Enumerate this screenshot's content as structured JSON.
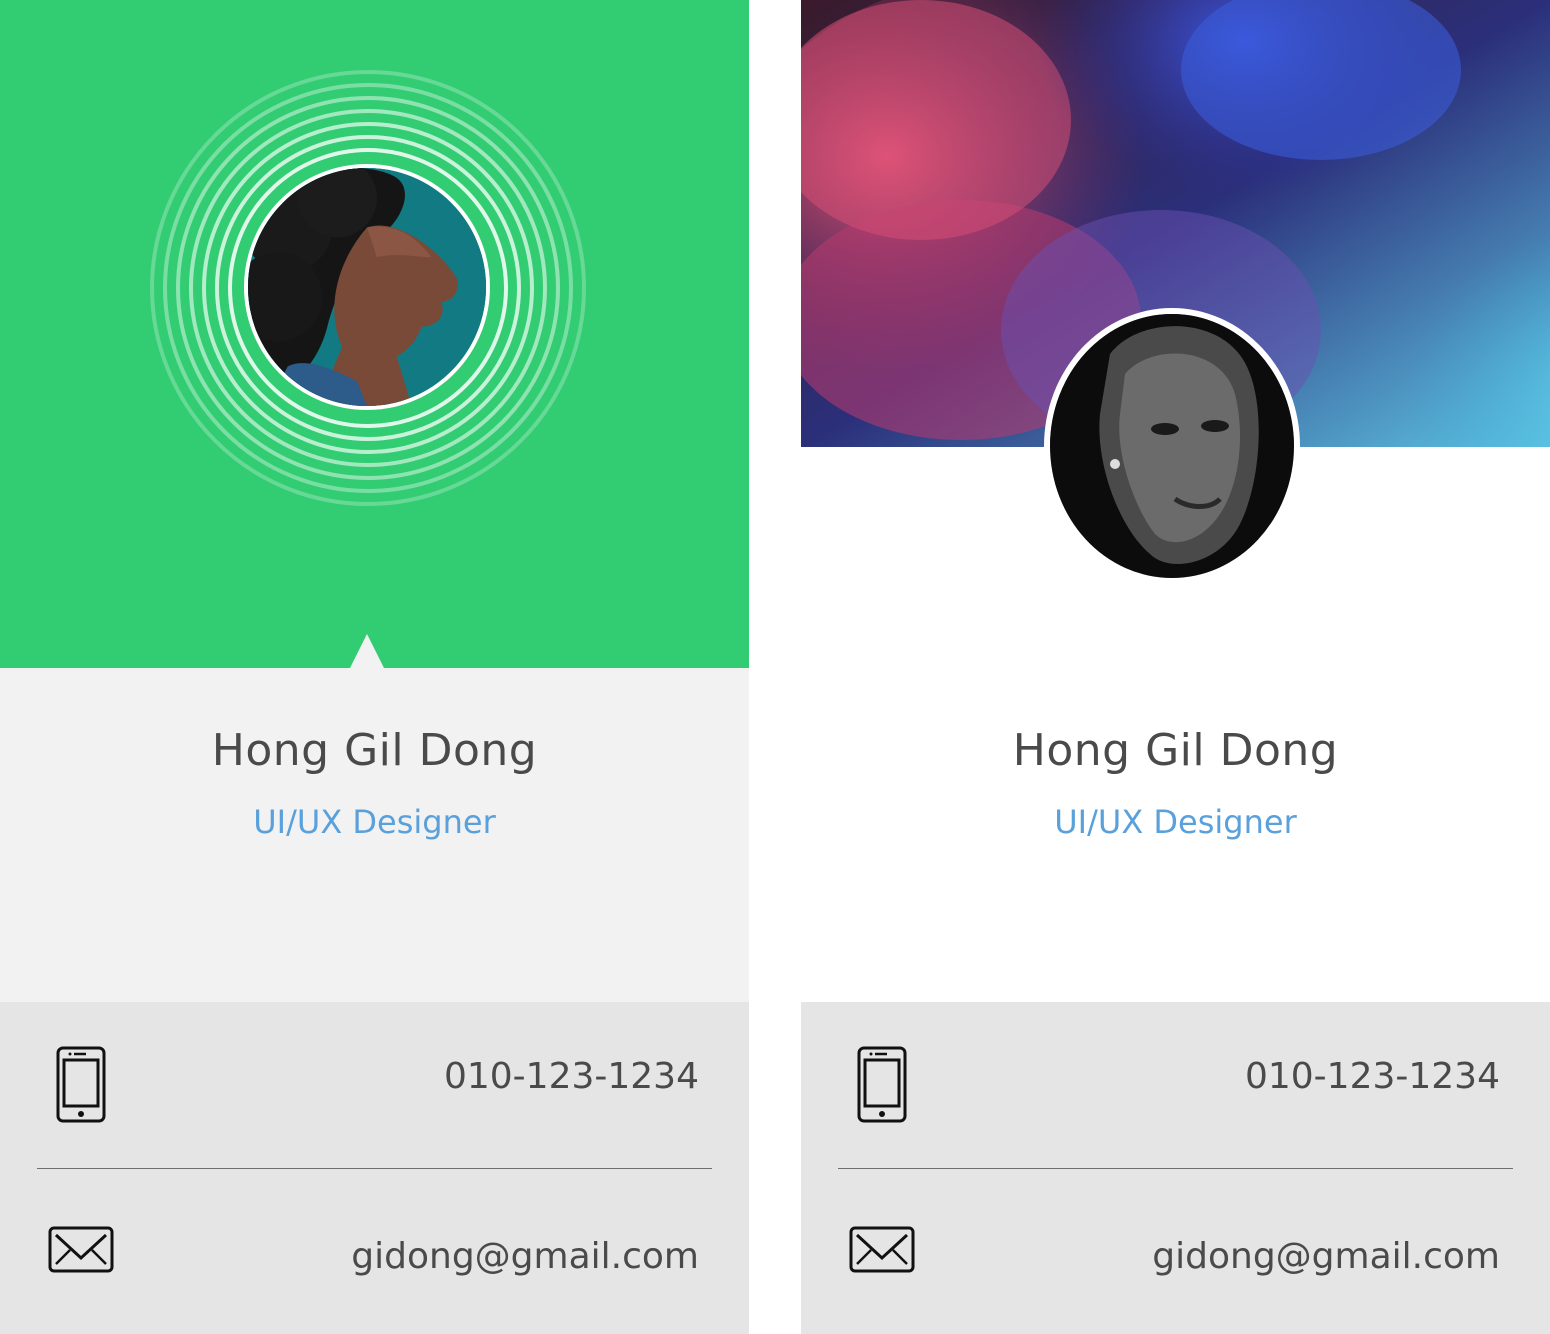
{
  "cards": [
    {
      "name": "Hong Gil Dong",
      "role": "UI/UX Designer",
      "phone": "010-123-1234",
      "email": "gidong@gmail.com",
      "header_color": "#32cd72"
    },
    {
      "name": "Hong Gil Dong",
      "role": "UI/UX Designer",
      "phone": "010-123-1234",
      "email": "gidong@gmail.com",
      "header_image": "colorful-smoke-cover"
    }
  ],
  "colors": {
    "role_text": "#5aa1dc",
    "name_text": "#4a4a4a",
    "contact_bg": "#e5e5e5",
    "info_bg_left": "#f2f2f2"
  },
  "icons": [
    "mobile-phone-icon",
    "envelope-icon"
  ]
}
